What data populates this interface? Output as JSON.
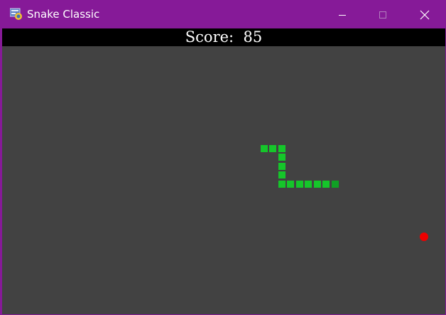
{
  "window": {
    "title": "Snake Classic",
    "icon": "python-app-icon",
    "controls": [
      "minimize-icon",
      "maximize-icon",
      "close-icon"
    ]
  },
  "scoreboard": {
    "label": "Score:",
    "value": "85"
  },
  "game": {
    "background_color": "#424242",
    "snake_color": "#15c62a",
    "snake_head_color": "#10a024",
    "food_color": "#ee0000",
    "snake_length": 13
  }
}
